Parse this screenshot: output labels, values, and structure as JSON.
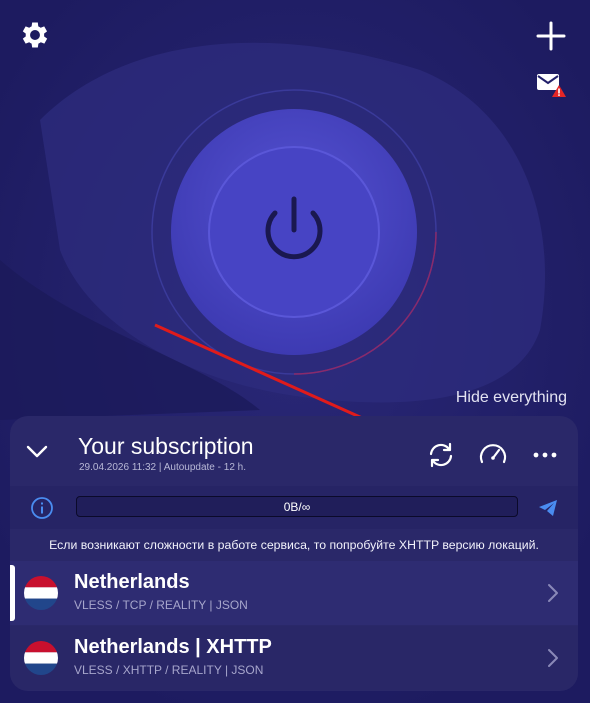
{
  "header": {
    "settings_icon": "gear-icon",
    "add_icon": "plus-icon",
    "mail_icon": "mail-alert-icon"
  },
  "power": {
    "icon": "power-icon",
    "state": "disconnected"
  },
  "hide_everything_label": "Hide everything",
  "subscription": {
    "title": "Your subscription",
    "meta": "29.04.2026 11:32 | Autoupdate - 12 h.",
    "actions": [
      "refresh-icon",
      "speedometer-icon",
      "more-icon"
    ]
  },
  "traffic": {
    "label": "0B/∞",
    "info_icon": "info-icon",
    "share_icon": "telegram-icon"
  },
  "notice": "Если возникают сложности в работе сервиса, то попробуйте XHTTP версию локаций.",
  "servers": [
    {
      "name": "Netherlands",
      "protocol": "VLESS / TCP / REALITY | JSON",
      "active": true
    },
    {
      "name": "Netherlands | XHTTP",
      "protocol": "VLESS / XHTTP / REALITY | JSON",
      "active": false
    }
  ],
  "colors": {
    "background": "#22206a",
    "panel": "#2a2869",
    "power_button": "#4744c4",
    "annotation_arrow": "#e01b1b",
    "accent": "#4a8cf0"
  }
}
